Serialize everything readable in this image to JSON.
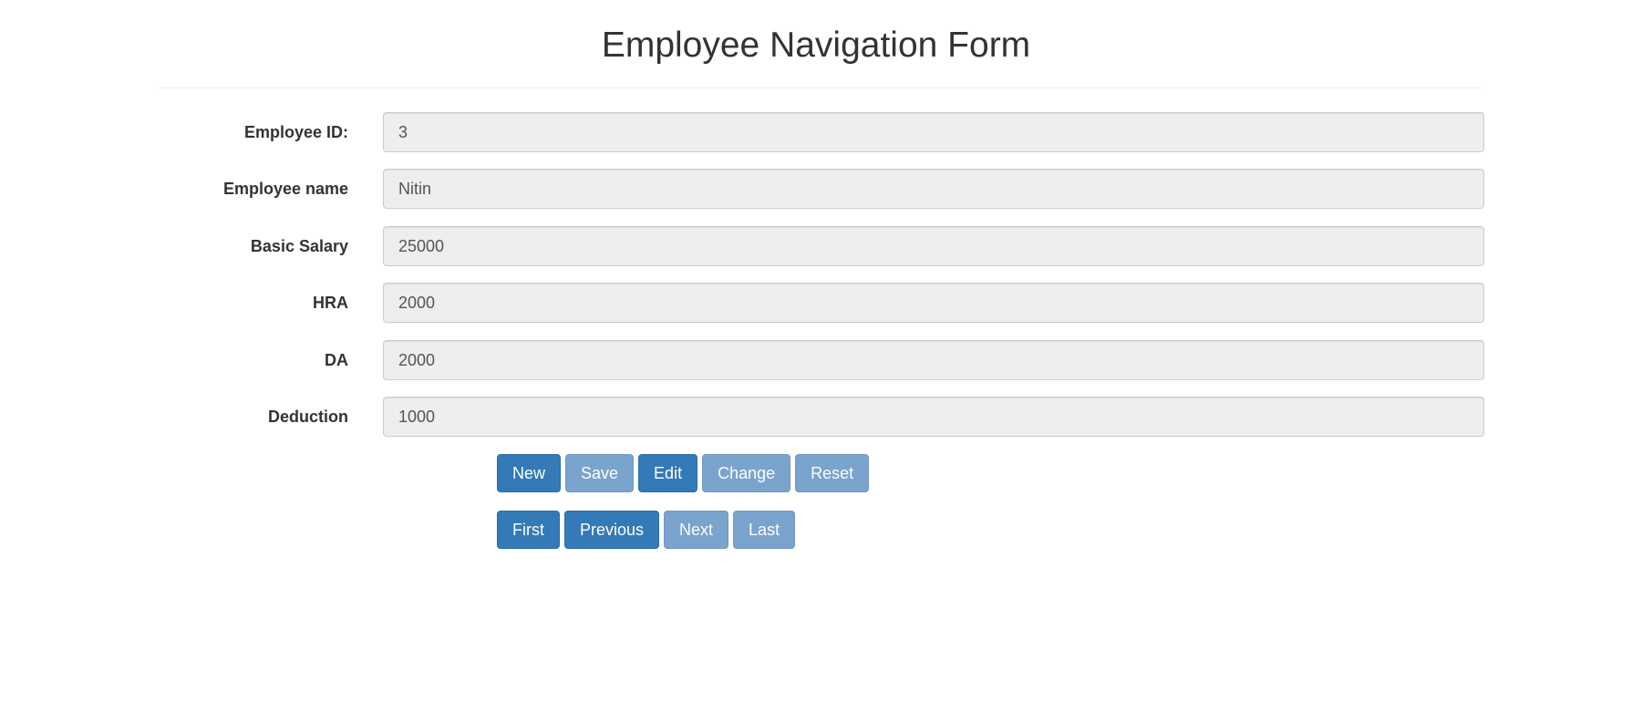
{
  "page": {
    "title": "Employee Navigation Form"
  },
  "form": {
    "fields": [
      {
        "label": "Employee ID:",
        "value": "3"
      },
      {
        "label": "Employee name",
        "value": "Nitin"
      },
      {
        "label": "Basic Salary",
        "value": "25000"
      },
      {
        "label": "HRA",
        "value": "2000"
      },
      {
        "label": "DA",
        "value": "2000"
      },
      {
        "label": "Deduction",
        "value": "1000"
      }
    ]
  },
  "action_buttons": {
    "new": "New",
    "save": "Save",
    "edit": "Edit",
    "change": "Change",
    "reset": "Reset"
  },
  "nav_buttons": {
    "first": "First",
    "previous": "Previous",
    "next": "Next",
    "last": "Last"
  },
  "colors": {
    "primary": "#337ab7",
    "primary_disabled": "#7aa3cd",
    "input_background": "#eeeeee"
  }
}
